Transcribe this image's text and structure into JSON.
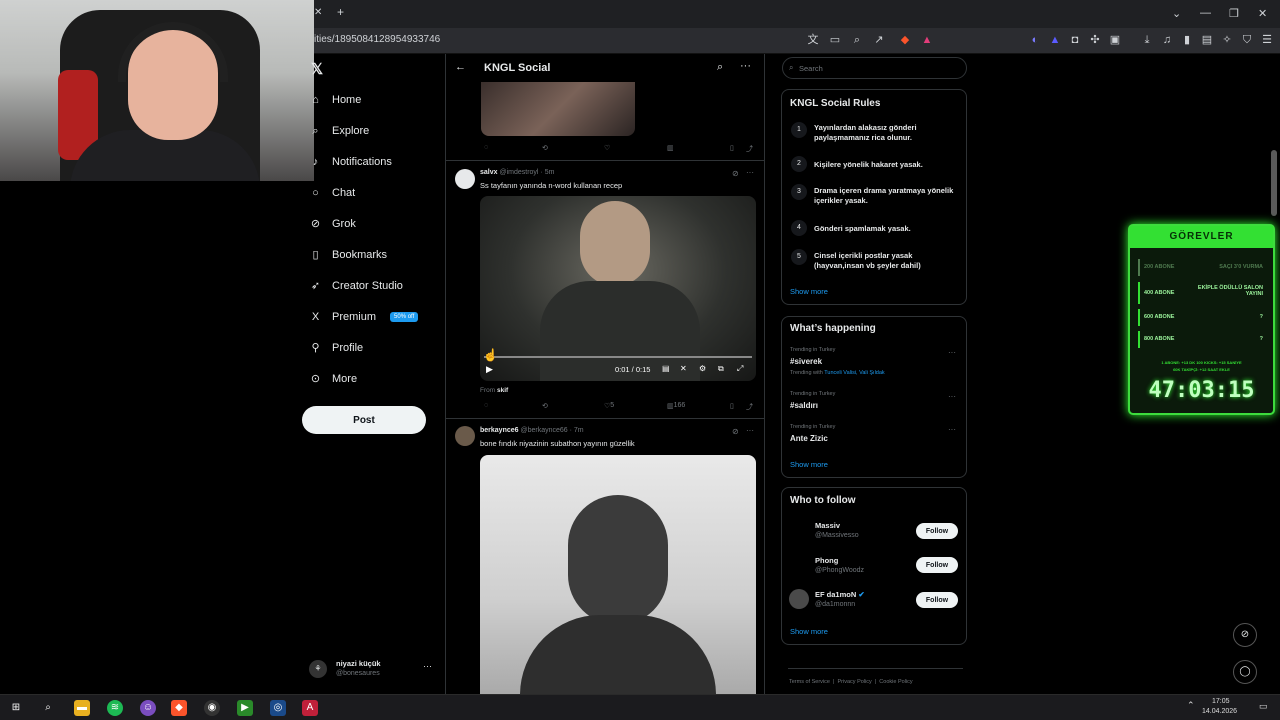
{
  "browser": {
    "new_tab": "+",
    "url": "ities/1895084128954933746"
  },
  "nav": {
    "items": [
      {
        "label": "Home",
        "icon": "home-icon",
        "glyph": "⌂"
      },
      {
        "label": "Explore",
        "icon": "search-icon",
        "glyph": "⌕"
      },
      {
        "label": "Notifications",
        "icon": "bell-icon",
        "glyph": "♪"
      },
      {
        "label": "Chat",
        "icon": "chat-icon",
        "glyph": "○"
      },
      {
        "label": "Grok",
        "icon": "grok-icon",
        "glyph": "⊘"
      },
      {
        "label": "Bookmarks",
        "icon": "bookmark-icon",
        "glyph": "▯"
      },
      {
        "label": "Creator Studio",
        "icon": "rocket-icon",
        "glyph": "➶"
      },
      {
        "label": "Premium",
        "icon": "x-logo-icon",
        "glyph": "X",
        "badge": "50% off"
      },
      {
        "label": "Profile",
        "icon": "person-icon",
        "glyph": "⚲"
      },
      {
        "label": "More",
        "icon": "more-circle-icon",
        "glyph": "⊙"
      }
    ],
    "post_button": "Post",
    "account": {
      "name": "niyazi küçük",
      "handle": "@bonesaures"
    }
  },
  "feed": {
    "title": "KNGL Social",
    "posts": [
      {
        "user": "salvx",
        "handle": "@imdestroyl",
        "time": "· 5m",
        "text": "Ss tayfanın yanında n-word kullanan recep",
        "video_time": "0:01 / 0:15",
        "from_label": "From",
        "from_user": "skif",
        "likes": "5",
        "views": "166"
      },
      {
        "user": "berkaynce6",
        "handle": "@berkaynce66",
        "time": "· 7m",
        "text": "bone fındık niyazinin subathon yayının güzellik"
      }
    ]
  },
  "right": {
    "search_placeholder": "Search",
    "rules": {
      "title": "KNGL Social Rules",
      "items": [
        {
          "num": "1",
          "text": "Yayınlardan alakasız gönderi paylaşmamanız rica olunur."
        },
        {
          "num": "2",
          "text": "Kişilere yönelik hakaret yasak."
        },
        {
          "num": "3",
          "text": "Drama içeren drama yaratmaya yönelik içerikler yasak."
        },
        {
          "num": "4",
          "text": "Gönderi spamlamak yasak."
        },
        {
          "num": "5",
          "text": "Cinsel içerikli postlar yasak (hayvan,insan vb şeyler dahil)"
        }
      ],
      "show_more": "Show more"
    },
    "happening": {
      "title": "What’s happening",
      "trends": [
        {
          "context": "Trending in Turkey",
          "name": "#siverek",
          "with_label": "Trending with",
          "with": "Tunceli Valisi, Vali Şıldak"
        },
        {
          "context": "Trending in Turkey",
          "name": "#saldırı"
        },
        {
          "context": "Trending in Turkey",
          "name": "Ante Zizic"
        }
      ],
      "show_more": "Show more"
    },
    "follow": {
      "title": "Who to follow",
      "users": [
        {
          "name": "Massiv",
          "handle": "@Massivesso",
          "button": "Follow"
        },
        {
          "name": "Phong",
          "handle": "@PhongWoodz",
          "button": "Follow"
        },
        {
          "name": "EF da1moN",
          "handle": "@da1monnn",
          "button": "Follow"
        }
      ],
      "show_more": "Show more"
    },
    "footer": {
      "terms": "Terms of Service",
      "privacy": "Privacy Policy",
      "cookie": "Cookie Policy"
    }
  },
  "widget": {
    "title": "GÖREVLER",
    "goals": [
      {
        "left": "200 ABONE",
        "right": "SAÇI 3'0 VURMA"
      },
      {
        "left": "400 ABONE",
        "right": "EKİPLE ÖDÜLLÜ SALON YAYINI"
      },
      {
        "left": "600 ABONE",
        "right": "?"
      },
      {
        "left": "800 ABONE",
        "right": "?"
      }
    ],
    "info1": "1 ABONE: +13 DK   100 KICKS: +15 SANİYE",
    "info2": "60K TAKİPÇİ: +12 SAAT EKLE",
    "timer": "47:03:15"
  },
  "taskbar": {
    "time": "17:05",
    "date": "14.04.2026"
  },
  "colors": {
    "accent": "#1d9bf0",
    "widget_green": "#33e033"
  }
}
